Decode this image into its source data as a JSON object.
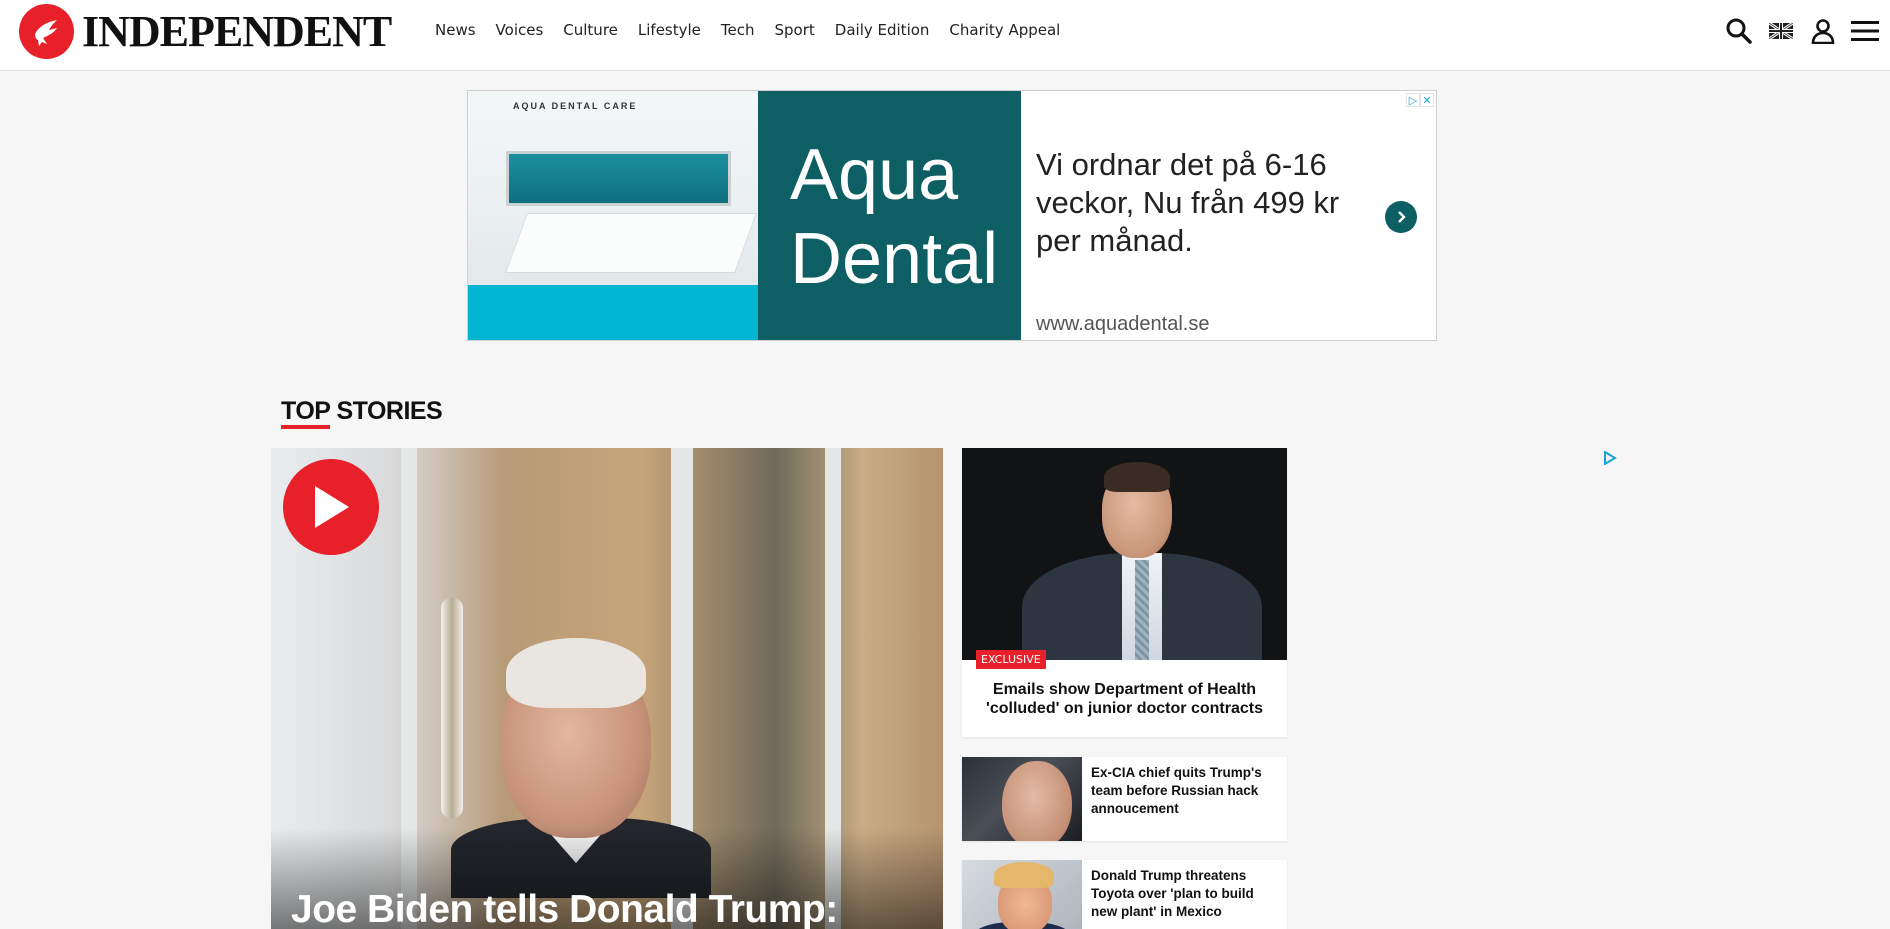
{
  "header": {
    "logo_text": "INDEPENDENT",
    "nav": [
      {
        "label": "News"
      },
      {
        "label": "Voices"
      },
      {
        "label": "Culture"
      },
      {
        "label": "Lifestyle"
      },
      {
        "label": "Tech"
      },
      {
        "label": "Sport"
      },
      {
        "label": "Daily Edition"
      },
      {
        "label": "Charity Appeal"
      }
    ],
    "icons": [
      "search-icon",
      "uk-flag-icon",
      "account-icon",
      "menu-icon"
    ]
  },
  "ad": {
    "photo_brand": "AQUA DENTAL CARE",
    "brand_line1": "Aqua",
    "brand_line2": "Dental",
    "copy": "Vi ordnar det på 6-16 veckor, Nu från 499 kr per månad.",
    "url": "www.aquadental.se",
    "choices": [
      "▷",
      "✕"
    ]
  },
  "top_stories": {
    "title_a": "TOP",
    "title_b": " STORIES",
    "lead": {
      "headline": "Joe Biden tells Donald Trump:"
    },
    "feature": {
      "badge": "EXCLUSIVE",
      "headline": "Emails show Department of Health 'colluded' on junior doctor contracts"
    },
    "list": [
      {
        "headline": "Ex-CIA chief quits Trump's team before Russian hack annoucement"
      },
      {
        "headline": "Donald Trump threatens Toyota over 'plan to build new plant' in Mexico"
      }
    ]
  },
  "colors": {
    "brand_red": "#e8202a",
    "ad_teal": "#0d5f63",
    "ad_cyan": "#00b6d3"
  }
}
